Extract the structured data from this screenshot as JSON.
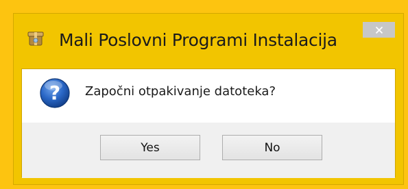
{
  "window": {
    "title": "Mali Poslovni Programi Instalacija",
    "app_icon": "installer-box-icon",
    "close_icon": "close-icon"
  },
  "message": {
    "icon": "question-icon",
    "text": "Započni otpakivanje datoteka?"
  },
  "buttons": {
    "yes_label": "Yes",
    "no_label": "No"
  },
  "colors": {
    "desktop_background": "#fdc410",
    "window_frame": "#f2c500",
    "close_button": "#c7c7c7",
    "client_background": "#ffffff",
    "button_bar": "#f0f0f0",
    "question_icon_blue": "#1f5bb5"
  }
}
